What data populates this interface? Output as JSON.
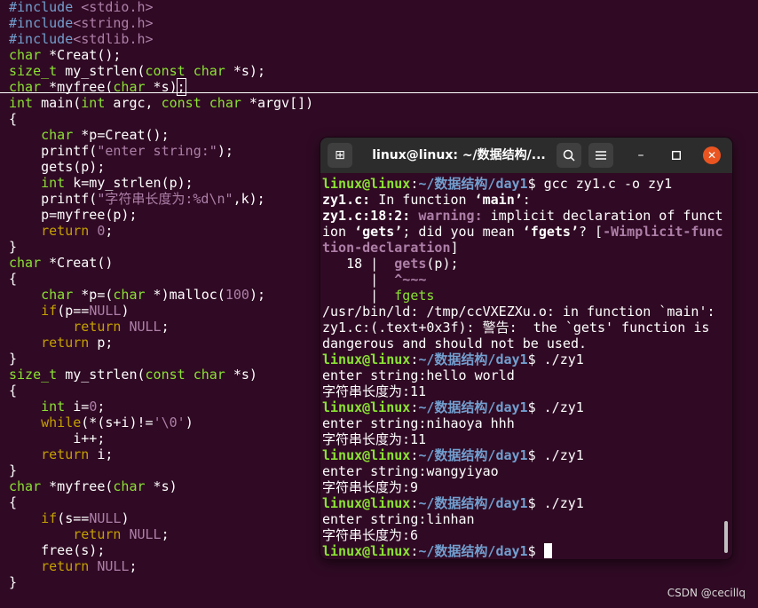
{
  "editor": {
    "lines": [
      [
        [
          "#include ",
          "pre"
        ],
        [
          "<stdio.h>",
          "pre-arg"
        ]
      ],
      [
        [
          "#include",
          "pre"
        ],
        [
          "<string.h>",
          "pre-arg"
        ]
      ],
      [
        [
          "#include",
          "pre"
        ],
        [
          "<stdlib.h>",
          "pre-arg"
        ]
      ],
      [
        [
          "char",
          "type"
        ],
        [
          " *Creat();",
          ""
        ]
      ],
      [
        [
          "size_t",
          "type"
        ],
        [
          " my_strlen(",
          ""
        ],
        [
          "const",
          "type"
        ],
        [
          " ",
          ""
        ],
        [
          "char",
          "type"
        ],
        [
          " *s);",
          ""
        ]
      ],
      [
        [
          "char",
          "type"
        ],
        [
          " *myfree(",
          ""
        ],
        [
          "char",
          "type"
        ],
        [
          " *s)",
          ""
        ],
        [
          ";",
          "cursor-box"
        ]
      ],
      [
        [
          "int",
          "type"
        ],
        [
          " main(",
          ""
        ],
        [
          "int",
          "type"
        ],
        [
          " argc, ",
          ""
        ],
        [
          "const",
          "type"
        ],
        [
          " ",
          ""
        ],
        [
          "char",
          "type"
        ],
        [
          " *argv[])",
          ""
        ]
      ],
      [
        [
          "{",
          ""
        ]
      ],
      [
        [
          "    ",
          ""
        ],
        [
          "char",
          "type"
        ],
        [
          " *p=Creat();",
          ""
        ]
      ],
      [
        [
          "    printf(",
          ""
        ],
        [
          "\"enter string:\"",
          "str"
        ],
        [
          ");",
          ""
        ]
      ],
      [
        [
          "    gets(p);",
          ""
        ]
      ],
      [
        [
          "    ",
          ""
        ],
        [
          "int",
          "type"
        ],
        [
          " k=my_strlen(p);",
          ""
        ]
      ],
      [
        [
          "    printf(",
          ""
        ],
        [
          "\"字符串长度为:%d\\n\"",
          "str"
        ],
        [
          ",k);",
          ""
        ]
      ],
      [
        [
          "    p=myfree(p);",
          ""
        ]
      ],
      [
        [
          "    ",
          ""
        ],
        [
          "return",
          "kw"
        ],
        [
          " ",
          ""
        ],
        [
          "0",
          "num"
        ],
        [
          ";",
          ""
        ]
      ],
      [
        [
          "}",
          ""
        ]
      ],
      [
        [
          "char",
          "type"
        ],
        [
          " *Creat()",
          ""
        ]
      ],
      [
        [
          "{",
          ""
        ]
      ],
      [
        [
          "    ",
          ""
        ],
        [
          "char",
          "type"
        ],
        [
          " *p=(",
          ""
        ],
        [
          "char",
          "type"
        ],
        [
          " *)malloc(",
          ""
        ],
        [
          "100",
          "num"
        ],
        [
          ");",
          ""
        ]
      ],
      [
        [
          "    ",
          ""
        ],
        [
          "if",
          "kw"
        ],
        [
          "(p==",
          ""
        ],
        [
          "NULL",
          "num"
        ],
        [
          ")",
          ""
        ]
      ],
      [
        [
          "        ",
          ""
        ],
        [
          "return",
          "kw"
        ],
        [
          " ",
          ""
        ],
        [
          "NULL",
          "num"
        ],
        [
          ";",
          ""
        ]
      ],
      [
        [
          "    ",
          ""
        ],
        [
          "return",
          "kw"
        ],
        [
          " p;",
          ""
        ]
      ],
      [
        [
          "}",
          ""
        ]
      ],
      [
        [
          "size_t",
          "type"
        ],
        [
          " my_strlen(",
          ""
        ],
        [
          "const",
          "type"
        ],
        [
          " ",
          ""
        ],
        [
          "char",
          "type"
        ],
        [
          " *s)",
          ""
        ]
      ],
      [
        [
          "{",
          ""
        ]
      ],
      [
        [
          "    ",
          ""
        ],
        [
          "int",
          "type"
        ],
        [
          " i=",
          ""
        ],
        [
          "0",
          "num"
        ],
        [
          ";",
          ""
        ]
      ],
      [
        [
          "    ",
          ""
        ],
        [
          "while",
          "kw"
        ],
        [
          "(*(s+i)!=",
          ""
        ],
        [
          "'\\0'",
          "str"
        ],
        [
          ")",
          ""
        ]
      ],
      [
        [
          "        i++;",
          ""
        ]
      ],
      [
        [
          "    ",
          ""
        ],
        [
          "return",
          "kw"
        ],
        [
          " i;",
          ""
        ]
      ],
      [
        [
          "}",
          ""
        ]
      ],
      [
        [
          "char",
          "type"
        ],
        [
          " *myfree(",
          ""
        ],
        [
          "char",
          "type"
        ],
        [
          " *s)",
          ""
        ]
      ],
      [
        [
          "{",
          ""
        ]
      ],
      [
        [
          "    ",
          ""
        ],
        [
          "if",
          "kw"
        ],
        [
          "(s==",
          ""
        ],
        [
          "NULL",
          "num"
        ],
        [
          ")",
          ""
        ]
      ],
      [
        [
          "        ",
          ""
        ],
        [
          "return",
          "kw"
        ],
        [
          " ",
          ""
        ],
        [
          "NULL",
          "num"
        ],
        [
          ";",
          ""
        ]
      ],
      [
        [
          "    free(s);",
          ""
        ]
      ],
      [
        [
          "    ",
          ""
        ],
        [
          "return",
          "kw"
        ],
        [
          " ",
          ""
        ],
        [
          "NULL",
          "num"
        ],
        [
          ";",
          ""
        ]
      ],
      [
        [
          "}",
          ""
        ]
      ]
    ]
  },
  "terminal": {
    "title": "linux@linux: ~/数据结构/...",
    "new_tab_icon": "new-tab-icon",
    "search_icon": "search-icon",
    "menu_icon": "hamburger-menu-icon",
    "minimize_icon": "minimize-icon",
    "maximize_icon": "maximize-icon",
    "close_icon": "close-icon",
    "lines": [
      [
        [
          "linux@linux",
          "pu"
        ],
        [
          ":",
          ""
        ],
        [
          "~/数据结构/day1",
          "pp"
        ],
        [
          "$ gcc zy1.c -o zy1",
          ""
        ]
      ],
      [
        [
          "zy1.c:",
          "b"
        ],
        [
          " In function ",
          ""
        ],
        [
          "‘main’",
          "b"
        ],
        [
          ":",
          ""
        ]
      ],
      [
        [
          "zy1.c:18:2:",
          "b"
        ],
        [
          " ",
          ""
        ],
        [
          "warning:",
          "warn"
        ],
        [
          " implicit declaration of funct",
          ""
        ]
      ],
      [
        [
          "ion ",
          ""
        ],
        [
          "‘gets’",
          "b"
        ],
        [
          "; did you mean ",
          ""
        ],
        [
          "‘fgets’",
          "b"
        ],
        [
          "? [",
          ""
        ],
        [
          "-Wimplicit-func",
          "flag"
        ]
      ],
      [
        [
          "tion-declaration",
          "flag"
        ],
        [
          "]",
          ""
        ]
      ],
      [
        [
          "   18 |  ",
          ""
        ],
        [
          "gets",
          "warn"
        ],
        [
          "(p);",
          ""
        ]
      ],
      [
        [
          "      |  ",
          ""
        ],
        [
          "^~~~",
          "warn"
        ]
      ],
      [
        [
          "      |  ",
          ""
        ],
        [
          "fgets",
          "gr"
        ]
      ],
      [
        [
          "/usr/bin/ld: /tmp/ccVXEZXu.o: in function `main':",
          ""
        ]
      ],
      [
        [
          "zy1.c:(.text+0x3f): 警告:  the `gets' function is",
          ""
        ]
      ],
      [
        [
          "dangerous and should not be used.",
          ""
        ]
      ],
      [
        [
          "linux@linux",
          "pu"
        ],
        [
          ":",
          ""
        ],
        [
          "~/数据结构/day1",
          "pp"
        ],
        [
          "$ ./zy1",
          ""
        ]
      ],
      [
        [
          "enter string:hello world",
          ""
        ]
      ],
      [
        [
          "字符串长度为:11",
          ""
        ]
      ],
      [
        [
          "linux@linux",
          "pu"
        ],
        [
          ":",
          ""
        ],
        [
          "~/数据结构/day1",
          "pp"
        ],
        [
          "$ ./zy1",
          ""
        ]
      ],
      [
        [
          "enter string:nihaoya hhh",
          ""
        ]
      ],
      [
        [
          "字符串长度为:11",
          ""
        ]
      ],
      [
        [
          "linux@linux",
          "pu"
        ],
        [
          ":",
          ""
        ],
        [
          "~/数据结构/day1",
          "pp"
        ],
        [
          "$ ./zy1",
          ""
        ]
      ],
      [
        [
          "enter string:wangyiyao",
          ""
        ]
      ],
      [
        [
          "字符串长度为:9",
          ""
        ]
      ],
      [
        [
          "linux@linux",
          "pu"
        ],
        [
          ":",
          ""
        ],
        [
          "~/数据结构/day1",
          "pp"
        ],
        [
          "$ ./zy1",
          ""
        ]
      ],
      [
        [
          "enter string:linhan",
          ""
        ]
      ],
      [
        [
          "字符串长度为:6",
          ""
        ]
      ],
      [
        [
          "linux@linux",
          "pu"
        ],
        [
          ":",
          ""
        ],
        [
          "~/数据结构/day1",
          "pp"
        ],
        [
          "$ ",
          ""
        ]
      ]
    ]
  },
  "watermark": "CSDN @cecillq"
}
